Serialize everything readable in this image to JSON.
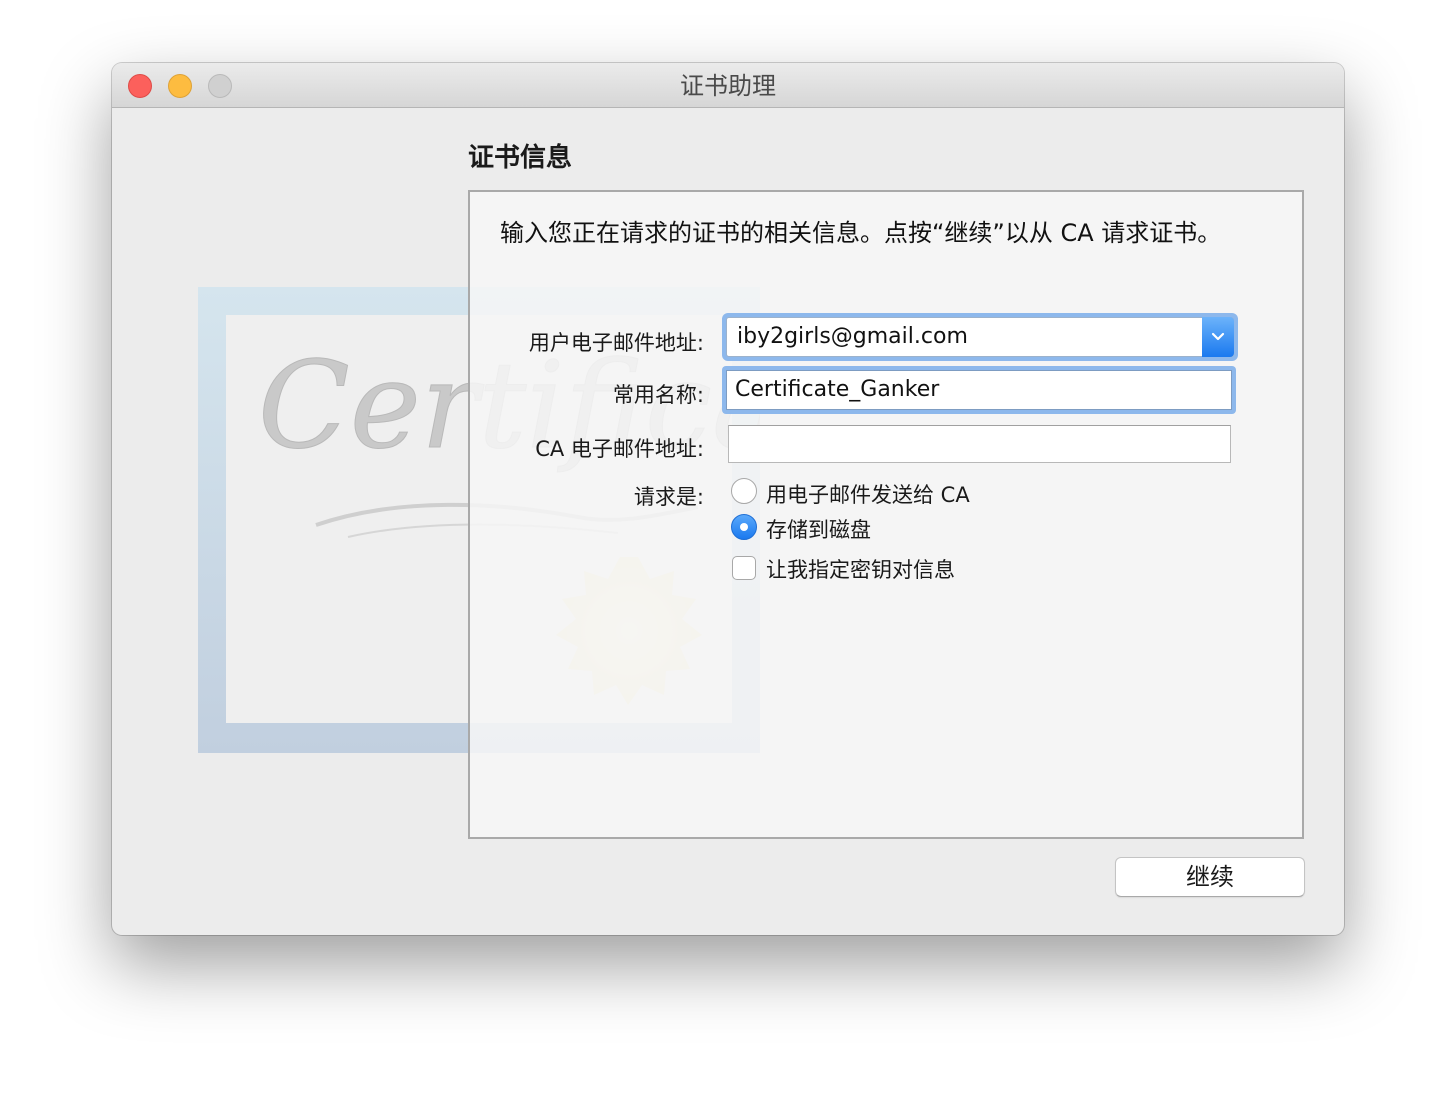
{
  "window": {
    "title": "证书助理",
    "controls": [
      "close-button",
      "minimize-button",
      "zoom-button"
    ]
  },
  "main": {
    "section_title": "证书信息",
    "description": "输入您正在请求的证书的相关信息。点按“继续”以从 CA 请求证书。",
    "background_art_icon": "certificate-illustration"
  },
  "form": {
    "email_label": "用户电子邮件地址:",
    "email_value": "iby2girls@gmail.com",
    "common_name_label": "常用名称:",
    "common_name_value": "Certificate_Ganker",
    "ca_email_label": "CA 电子邮件地址:",
    "ca_email_value": "",
    "request_label": "请求是:",
    "options": [
      {
        "label": "用电子邮件发送给 CA",
        "selected": false
      },
      {
        "label": "存储到磁盘",
        "selected": true
      }
    ],
    "checkbox_label": "让我指定密钥对信息",
    "checkbox_checked": false
  },
  "footer": {
    "continue_label": "继续"
  },
  "colors": {
    "accent": "#1a79ef",
    "focus_ring": "#8db8ec",
    "close": "#fc605c",
    "minimize": "#fdbc40"
  }
}
